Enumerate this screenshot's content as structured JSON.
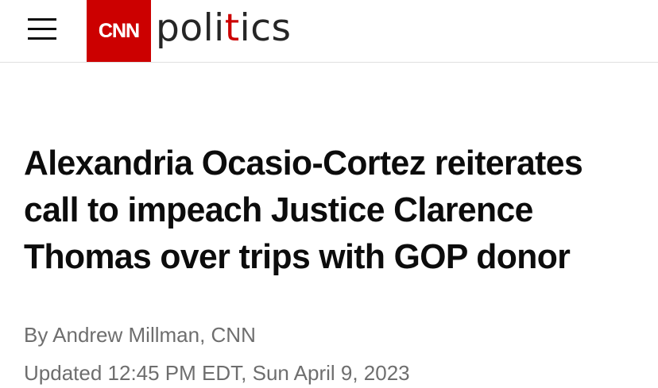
{
  "header": {
    "menu_icon": "hamburger-menu-icon",
    "logo_text": "CNN",
    "logo_color": "#cc0000",
    "section": {
      "part1": "poli",
      "accent": "t",
      "part2": "ics",
      "accent_color": "#cc0000"
    }
  },
  "article": {
    "headline": "Alexandria Ocasio-Cortez reiterates call to impeach Justice Clarence Thomas over trips with GOP donor",
    "byline_prefix": "By ",
    "author": "Andrew Millman, CNN",
    "timestamp": "Updated 12:45 PM EDT, Sun April 9, 2023"
  }
}
